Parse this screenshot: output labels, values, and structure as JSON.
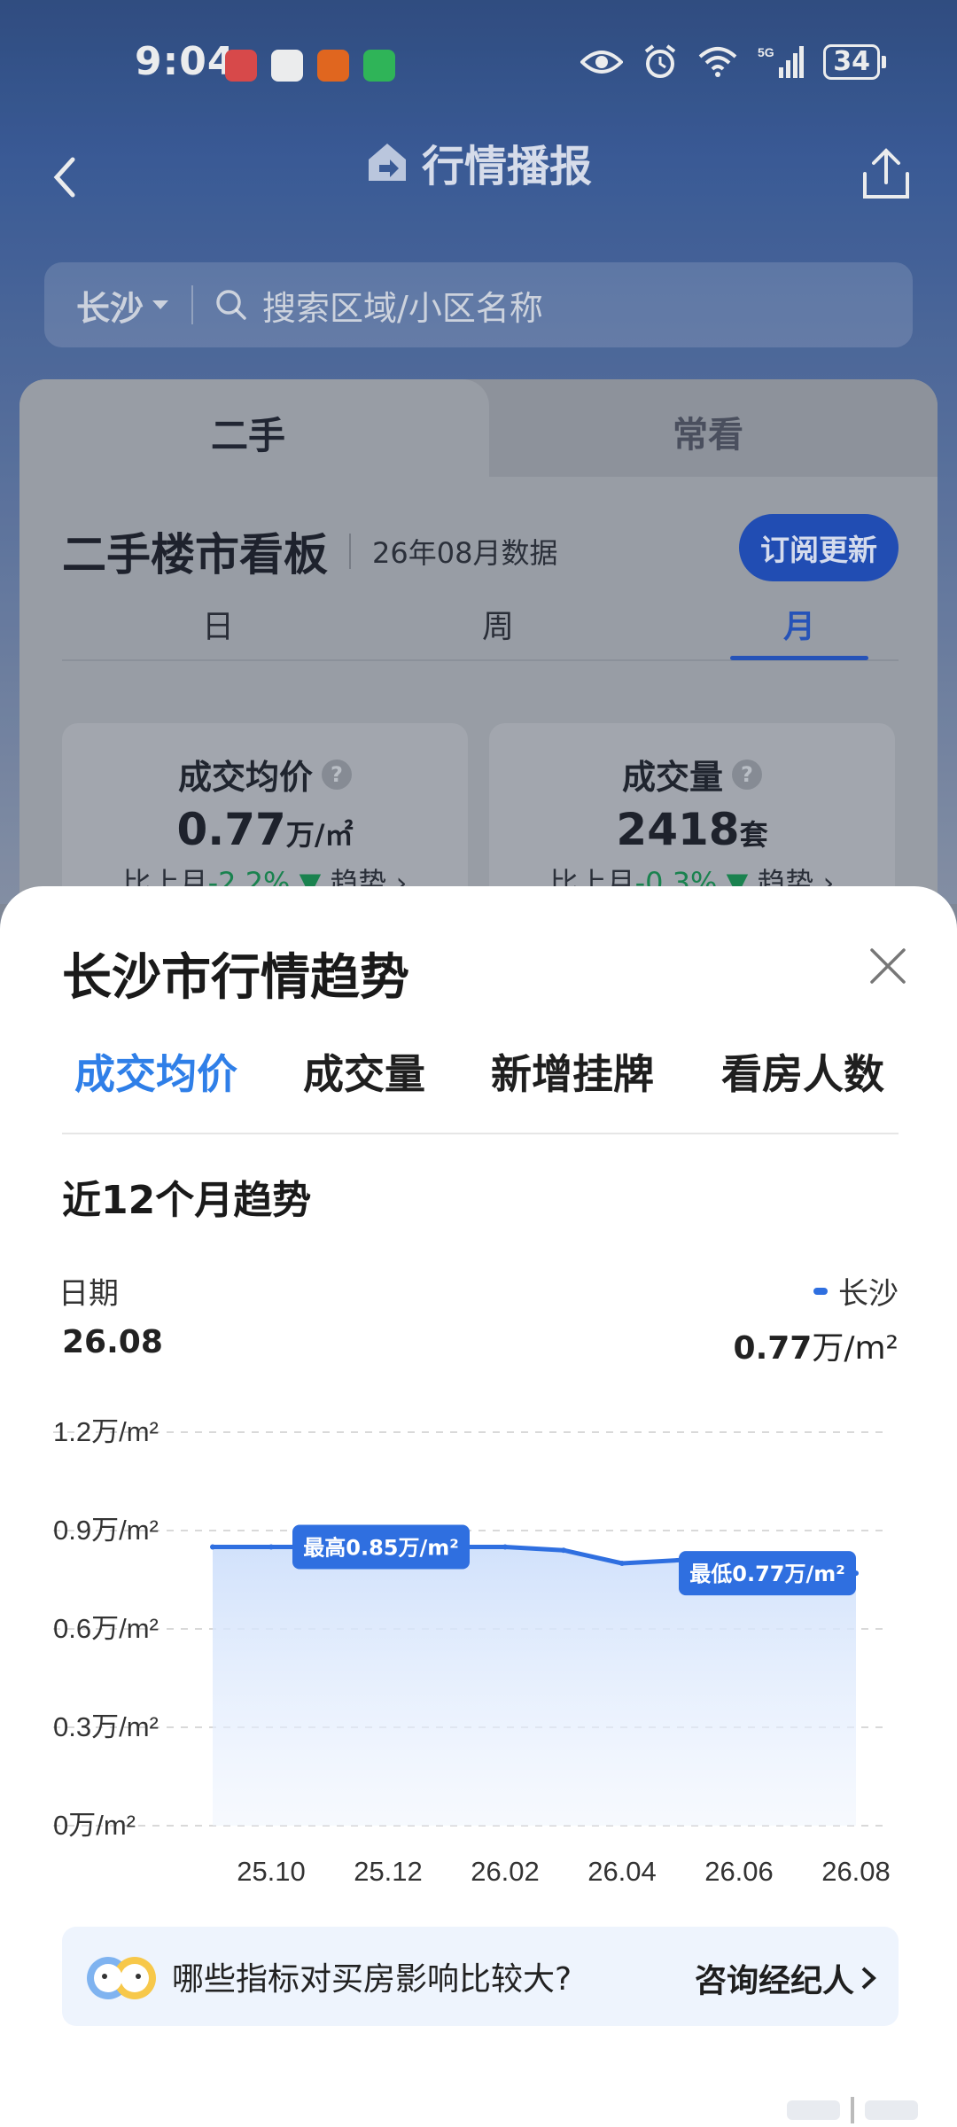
{
  "status_bar": {
    "time": "9:04",
    "battery": "34",
    "network": "5G"
  },
  "nav": {
    "title": "行情播报"
  },
  "search": {
    "city": "长沙",
    "placeholder": "搜索区域/小区名称"
  },
  "board": {
    "tabs": [
      "二手",
      "常看"
    ],
    "title": "二手楼市看板",
    "data_date": "26年08月数据",
    "subscribe_label": "订阅更新",
    "periods": [
      "日",
      "周",
      "月"
    ],
    "active_period": "月",
    "cards": [
      {
        "label": "成交均价",
        "value": "0.77",
        "unit": "万/㎡",
        "compare_label": "比上月",
        "change": "-2.2%",
        "trend_label": "趋势"
      },
      {
        "label": "成交量",
        "value": "2418",
        "unit": "套",
        "compare_label": "比上月",
        "change": "-0.3%",
        "trend_label": "趋势"
      }
    ]
  },
  "sheet": {
    "title": "长沙市行情趋势",
    "tabs": [
      "成交均价",
      "成交量",
      "新增挂牌",
      "看房人数"
    ],
    "active_tab": "成交均价",
    "section_title": "近12个月趋势",
    "date_label": "日期",
    "date_value": "26.08",
    "legend_name": "长沙",
    "legend_value": "0.77",
    "legend_unit": "万/m²",
    "tip_text": "哪些指标对买房影响比较大?",
    "tip_link": "咨询经纪人"
  },
  "colors": {
    "accent": "#2f7fe8",
    "line": "#2f6fe0",
    "board_button": "#1f4fbf",
    "down_green": "#178a50"
  },
  "chart_data": {
    "type": "area",
    "x": [
      "25.09",
      "25.10",
      "25.11",
      "25.12",
      "26.01",
      "26.02",
      "26.03",
      "26.04",
      "26.05",
      "26.06",
      "26.07",
      "26.08"
    ],
    "x_tick_labels": [
      "25.10",
      "25.12",
      "26.02",
      "26.04",
      "26.06",
      "26.08"
    ],
    "series": [
      {
        "name": "长沙",
        "values": [
          0.85,
          0.85,
          0.85,
          0.85,
          0.85,
          0.85,
          0.84,
          0.8,
          0.81,
          0.8,
          0.8,
          0.77
        ]
      }
    ],
    "y_ticks": [
      0,
      0.3,
      0.6,
      0.9,
      1.2
    ],
    "y_tick_labels": [
      "0万/m²",
      "0.3万/m²",
      "0.6万/m²",
      "0.9万/m²",
      "1.2万/m²"
    ],
    "ylim": [
      0,
      1.2
    ],
    "annotations": [
      {
        "text": "最高0.85万/m²",
        "x": "25.10",
        "y": 0.85
      },
      {
        "text": "最低0.77万/m²",
        "x": "26.08",
        "y": 0.77
      }
    ],
    "grid": true
  }
}
